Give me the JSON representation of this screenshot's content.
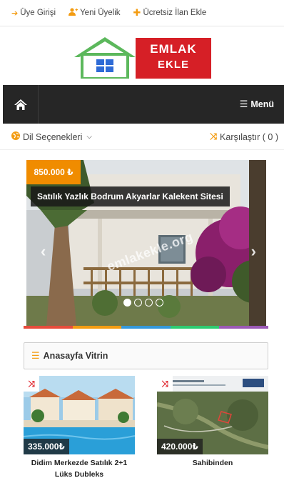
{
  "topbar": {
    "login": "Üye Girişi",
    "register": "Yeni Üyelik",
    "free_ad": "Ücretsiz İlan Ekle"
  },
  "logo": {
    "line1": "EMLAK",
    "line2": "EKLE"
  },
  "navbar": {
    "menu_label": "Menü"
  },
  "subbar": {
    "languages": "Dil Seçenekleri",
    "compare": "Karşılaştır ( 0 )"
  },
  "slider": {
    "price": "850.000 ₺",
    "caption": "Satılık Yazlık Bodrum Akyarlar Kalekent Sitesi",
    "watermark": "emlakekle.org",
    "active_slide": 1,
    "slide_count": 4
  },
  "colorbar": [
    "#e74c3c",
    "#f39c12",
    "#3498db",
    "#2ecc71",
    "#9b59b6"
  ],
  "showcase": {
    "title": "Anasayfa Vitrin",
    "cards": [
      {
        "price": "335.000₺",
        "title": "Didim Merkezde Satılık 2+1 Lüks Dubleks"
      },
      {
        "price": "420.000₺",
        "title": "Sahibinden"
      }
    ]
  },
  "colors": {
    "accent": "#f39c12",
    "navbar": "#262626",
    "logo_red": "#d61f26",
    "logo_green": "#5cb85c"
  }
}
